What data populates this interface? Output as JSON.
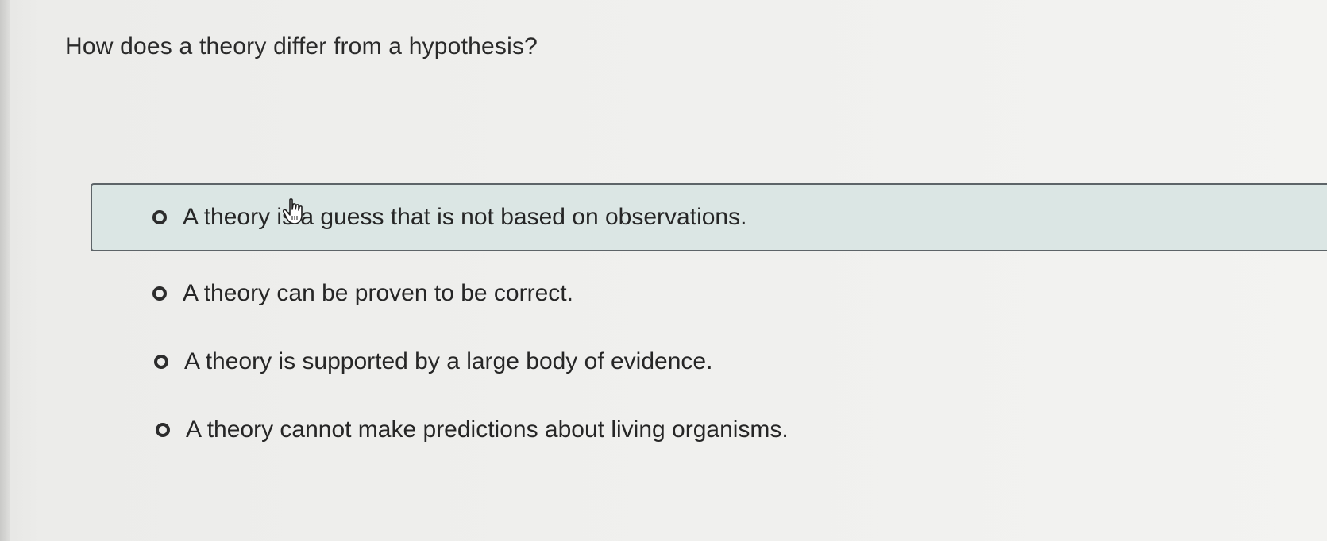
{
  "question": {
    "text": "How does a theory differ from a hypothesis?"
  },
  "options": [
    {
      "label": "A theory is a guess that is not based on observations.",
      "selected": false,
      "hovered": true
    },
    {
      "label": "A theory can be proven to be correct.",
      "selected": false,
      "hovered": false
    },
    {
      "label": "A theory is supported by a large body of evidence.",
      "selected": false,
      "hovered": false
    },
    {
      "label": "A theory cannot make predictions about living organisms.",
      "selected": false,
      "hovered": false
    }
  ],
  "colors": {
    "hover_background": "#dbe6e4",
    "hover_border": "#5d6468",
    "text": "#262626"
  },
  "icons": {
    "radio": "radio-button-icon",
    "cursor": "hand-pointer-cursor-icon"
  }
}
